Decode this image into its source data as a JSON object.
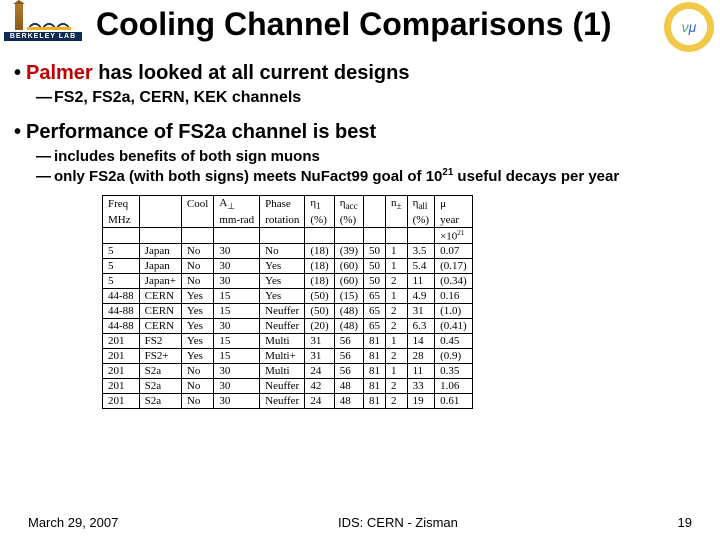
{
  "title": "Cooling Channel Comparisons (1)",
  "logo_left_label": "BERKELEY LAB",
  "bullets": {
    "b1_pre": "Palmer",
    "b1_post": " has looked at all current designs",
    "b1_sub": "FS2, FS2a, CERN, KEK channels",
    "b2": "Performance of FS2a channel is best",
    "b2_sub1": "includes benefits of both sign muons",
    "b2_sub2_a": "only FS2a (with both signs) meets NuFact99 goal of 10",
    "b2_sub2_exp": "21",
    "b2_sub2_b": " useful decays per year"
  },
  "table": {
    "head_top": [
      "Freq",
      "Cool",
      "Cool",
      "A⊥",
      "Phase",
      "η1",
      "ηacc",
      "n±",
      "ηall",
      "μ"
    ],
    "head_bot": [
      "MHz",
      "",
      "",
      "mm-rad",
      "rotation",
      "(%)",
      "(%)",
      "",
      "(%)",
      "year"
    ],
    "head_extra": [
      "",
      "",
      "",
      "",
      "",
      "",
      "",
      "",
      "",
      "×10²¹"
    ],
    "rows": [
      [
        "5",
        "Japan",
        "No",
        "30",
        "No",
        "(18)",
        "(39)",
        "50",
        "1",
        "3.5",
        "0.07"
      ],
      [
        "5",
        "Japan",
        "No",
        "30",
        "Yes",
        "(18)",
        "(60)",
        "50",
        "1",
        "5.4",
        "(0.17)"
      ],
      [
        "5",
        "Japan+",
        "No",
        "30",
        "Yes",
        "(18)",
        "(60)",
        "50",
        "2",
        "11",
        "(0.34)"
      ],
      [
        "44-88",
        "CERN",
        "Yes",
        "15",
        "Yes",
        "(50)",
        "(15)",
        "65",
        "1",
        "4.9",
        "0.16"
      ],
      [
        "44-88",
        "CERN",
        "Yes",
        "15",
        "Neuffer",
        "(50)",
        "(48)",
        "65",
        "2",
        "31",
        "(1.0)"
      ],
      [
        "44-88",
        "CERN",
        "Yes",
        "30",
        "Neuffer",
        "(20)",
        "(48)",
        "65",
        "2",
        "6.3",
        "(0.41)"
      ],
      [
        "201",
        "FS2",
        "Yes",
        "15",
        "Multi",
        "31",
        "56",
        "81",
        "1",
        "14",
        "0.45"
      ],
      [
        "201",
        "FS2+",
        "Yes",
        "15",
        "Multi+",
        "31",
        "56",
        "81",
        "2",
        "28",
        "(0.9)"
      ],
      [
        "201",
        "S2a",
        "No",
        "30",
        "Multi",
        "24",
        "56",
        "81",
        "1",
        "11",
        "0.35"
      ],
      [
        "201",
        "S2a",
        "No",
        "30",
        "Neuffer",
        "42",
        "48",
        "81",
        "2",
        "33",
        "1.06"
      ],
      [
        "201",
        "S2a",
        "No",
        "30",
        "Neuffer",
        "24",
        "48",
        "81",
        "2",
        "19",
        "0.61"
      ]
    ]
  },
  "footer": {
    "date": "March 29, 2007",
    "center": "IDS: CERN - Zisman",
    "page": "19"
  }
}
